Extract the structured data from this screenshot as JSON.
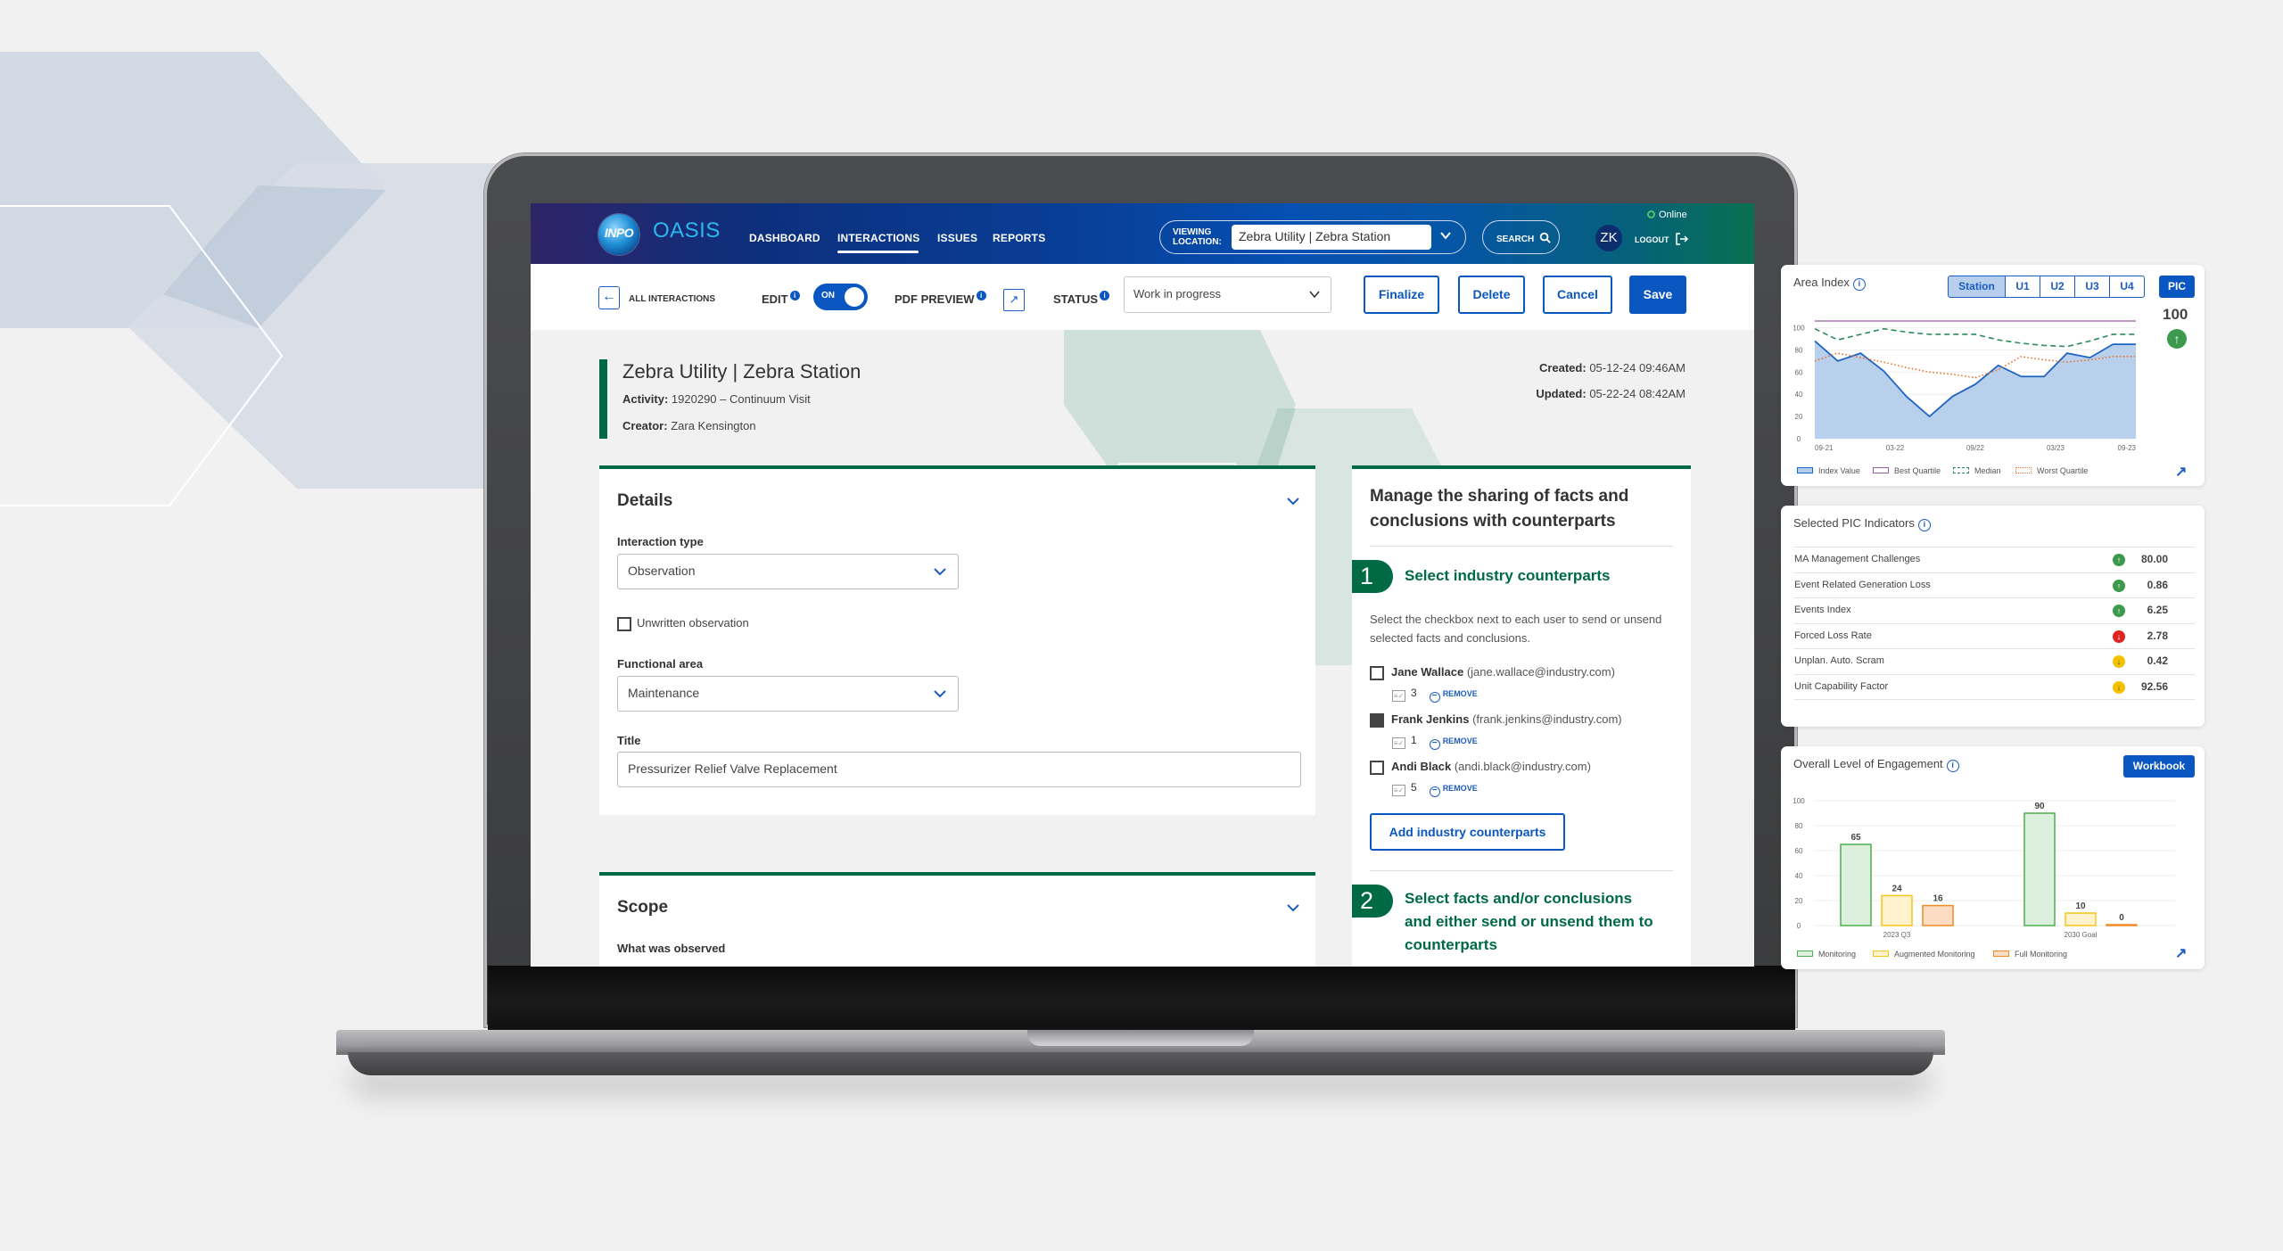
{
  "app": {
    "logo_text": "INPO",
    "brand": "OASIS",
    "nav": [
      {
        "label": "DASHBOARD",
        "active": false
      },
      {
        "label": "INTERACTIONS",
        "active": true
      },
      {
        "label": "ISSUES",
        "active": false
      },
      {
        "label": "REPORTS",
        "active": false
      }
    ],
    "viewing_location_label": "VIEWING LOCATION:",
    "viewing_location_value": "Zebra Utility | Zebra Station",
    "search_label": "SEARCH",
    "status_online": "Online",
    "user_initials": "ZK",
    "logout_label": "LOGOUT"
  },
  "toolbar": {
    "back_label": "ALL INTERACTIONS",
    "edit_label": "EDIT",
    "edit_toggle_text": "ON",
    "edit_on": true,
    "pdf_preview_label": "PDF PREVIEW",
    "status_label": "STATUS",
    "status_value": "Work in progress",
    "finalize_label": "Finalize",
    "delete_label": "Delete",
    "cancel_label": "Cancel",
    "save_label": "Save"
  },
  "record": {
    "title": "Zebra Utility | Zebra Station",
    "activity_label": "Activity:",
    "activity_value": "1920290 – Continuum Visit",
    "creator_label": "Creator:",
    "creator_value": "Zara Kensington",
    "created_label": "Created:",
    "created_value": "05-12-24 09:46AM",
    "updated_label": "Updated:",
    "updated_value": "05-22-24 08:42AM"
  },
  "details": {
    "heading": "Details",
    "interaction_type_label": "Interaction type",
    "interaction_type_value": "Observation",
    "unwritten_label": "Unwritten observation",
    "unwritten_checked": false,
    "functional_area_label": "Functional area",
    "functional_area_value": "Maintenance",
    "title_label": "Title",
    "title_value": "Pressurizer Relief Valve Replacement"
  },
  "scope": {
    "heading": "Scope",
    "what_observed_label": "What was observed"
  },
  "sharing": {
    "heading": "Manage the sharing of facts and conclusions with counterparts",
    "step1_number": "1",
    "step1_title": "Select industry counterparts",
    "step1_help": "Select the checkbox next to each user to send or unsend selected facts and conclusions.",
    "counterparts": [
      {
        "name": "Jane Wallace",
        "email": "(jane.wallace@industry.com)",
        "count": "3",
        "checked": false
      },
      {
        "name": "Frank Jenkins",
        "email": "(frank.jenkins@industry.com)",
        "count": "1",
        "checked": true
      },
      {
        "name": "Andi Black",
        "email": "(andi.black@industry.com)",
        "count": "5",
        "checked": false
      }
    ],
    "remove_label": "REMOVE",
    "add_button_label": "Add industry counterparts",
    "step2_number": "2",
    "step2_title": "Select facts and/or conclusions and either send or unsend them to counterparts"
  },
  "area_index": {
    "title": "Area Index",
    "segments": [
      {
        "label": "Station",
        "active": true
      },
      {
        "label": "U1",
        "active": false
      },
      {
        "label": "U2",
        "active": false
      },
      {
        "label": "U3",
        "active": false
      },
      {
        "label": "U4",
        "active": false
      }
    ],
    "pic_label": "PIC",
    "current_value": "100",
    "trend": "up"
  },
  "pic_indicators": {
    "title": "Selected PIC Indicators",
    "rows": [
      {
        "name": "MA Management Challenges",
        "value": "80.00",
        "trend": "up",
        "color": "#3b9a4b"
      },
      {
        "name": "Event Related Generation Loss",
        "value": "0.86",
        "trend": "up",
        "color": "#3b9a4b"
      },
      {
        "name": "Events Index",
        "value": "6.25",
        "trend": "up",
        "color": "#3b9a4b"
      },
      {
        "name": "Forced Loss Rate",
        "value": "2.78",
        "trend": "down",
        "color": "#e02424"
      },
      {
        "name": "Unplan. Auto. Scram",
        "value": "0.42",
        "trend": "down",
        "color": "#f2c200"
      },
      {
        "name": "Unit Capability Factor",
        "value": "92.56",
        "trend": "down",
        "color": "#f2c200"
      }
    ]
  },
  "engagement": {
    "title": "Overall Level of Engagement",
    "workbook_label": "Workbook"
  },
  "colors": {
    "brand_blue": "#0b57c2",
    "brand_green": "#006a45",
    "index_fill": "#b4cdea",
    "index_line": "#1f64c4",
    "best_quartile": "#9a5aa8",
    "median": "#2b8a5b",
    "worst_quartile": "#e8702a"
  },
  "chart_data": [
    {
      "type": "area",
      "title": "Area Index",
      "x": [
        "09-21",
        "",
        "",
        "03-22",
        "",
        "",
        "",
        "09/22",
        "",
        "",
        "",
        "03/23",
        "",
        "",
        "09-23"
      ],
      "x_tick_labels": [
        "09-21",
        "03-22",
        "09/22",
        "03/23",
        "09-23"
      ],
      "ylim": [
        0,
        100
      ],
      "y_ticks": [
        0,
        20,
        40,
        60,
        80,
        100
      ],
      "grid": true,
      "legend_position": "bottom",
      "series": [
        {
          "name": "Index Value",
          "style": "area",
          "values": [
            88,
            70,
            77,
            61,
            38,
            20,
            38,
            49,
            66,
            56,
            56,
            77,
            73,
            85,
            85
          ]
        },
        {
          "name": "Best Quartile",
          "style": "solid",
          "values": [
            106,
            106,
            106,
            106,
            106,
            106,
            106,
            106,
            106,
            106,
            106,
            106,
            106,
            106,
            106
          ]
        },
        {
          "name": "Median",
          "style": "dashed",
          "values": [
            99,
            89,
            94,
            99,
            96,
            94,
            94,
            94,
            89,
            86,
            84,
            83,
            88,
            94,
            94
          ]
        },
        {
          "name": "Worst Quartile",
          "style": "dotted",
          "values": [
            70,
            77,
            73,
            69,
            64,
            60,
            58,
            55,
            62,
            74,
            71,
            69,
            71,
            74,
            74
          ]
        }
      ]
    },
    {
      "type": "bar",
      "title": "Overall Level of Engagement",
      "categories": [
        "2023 Q3",
        "2030 Goal"
      ],
      "ylim": [
        0,
        100
      ],
      "y_ticks": [
        0,
        20,
        40,
        60,
        80,
        100
      ],
      "grid": true,
      "legend_position": "bottom",
      "series": [
        {
          "name": "Monitoring",
          "values": [
            65,
            90
          ],
          "stroke": "#4caf50",
          "fill": "#dcefdc"
        },
        {
          "name": "Augmented Monitoring",
          "values": [
            24,
            10
          ],
          "stroke": "#f5c518",
          "fill": "#fff2cc"
        },
        {
          "name": "Full Monitoring",
          "values": [
            16,
            0
          ],
          "stroke": "#f08a24",
          "fill": "#fcdcc3"
        }
      ]
    }
  ]
}
